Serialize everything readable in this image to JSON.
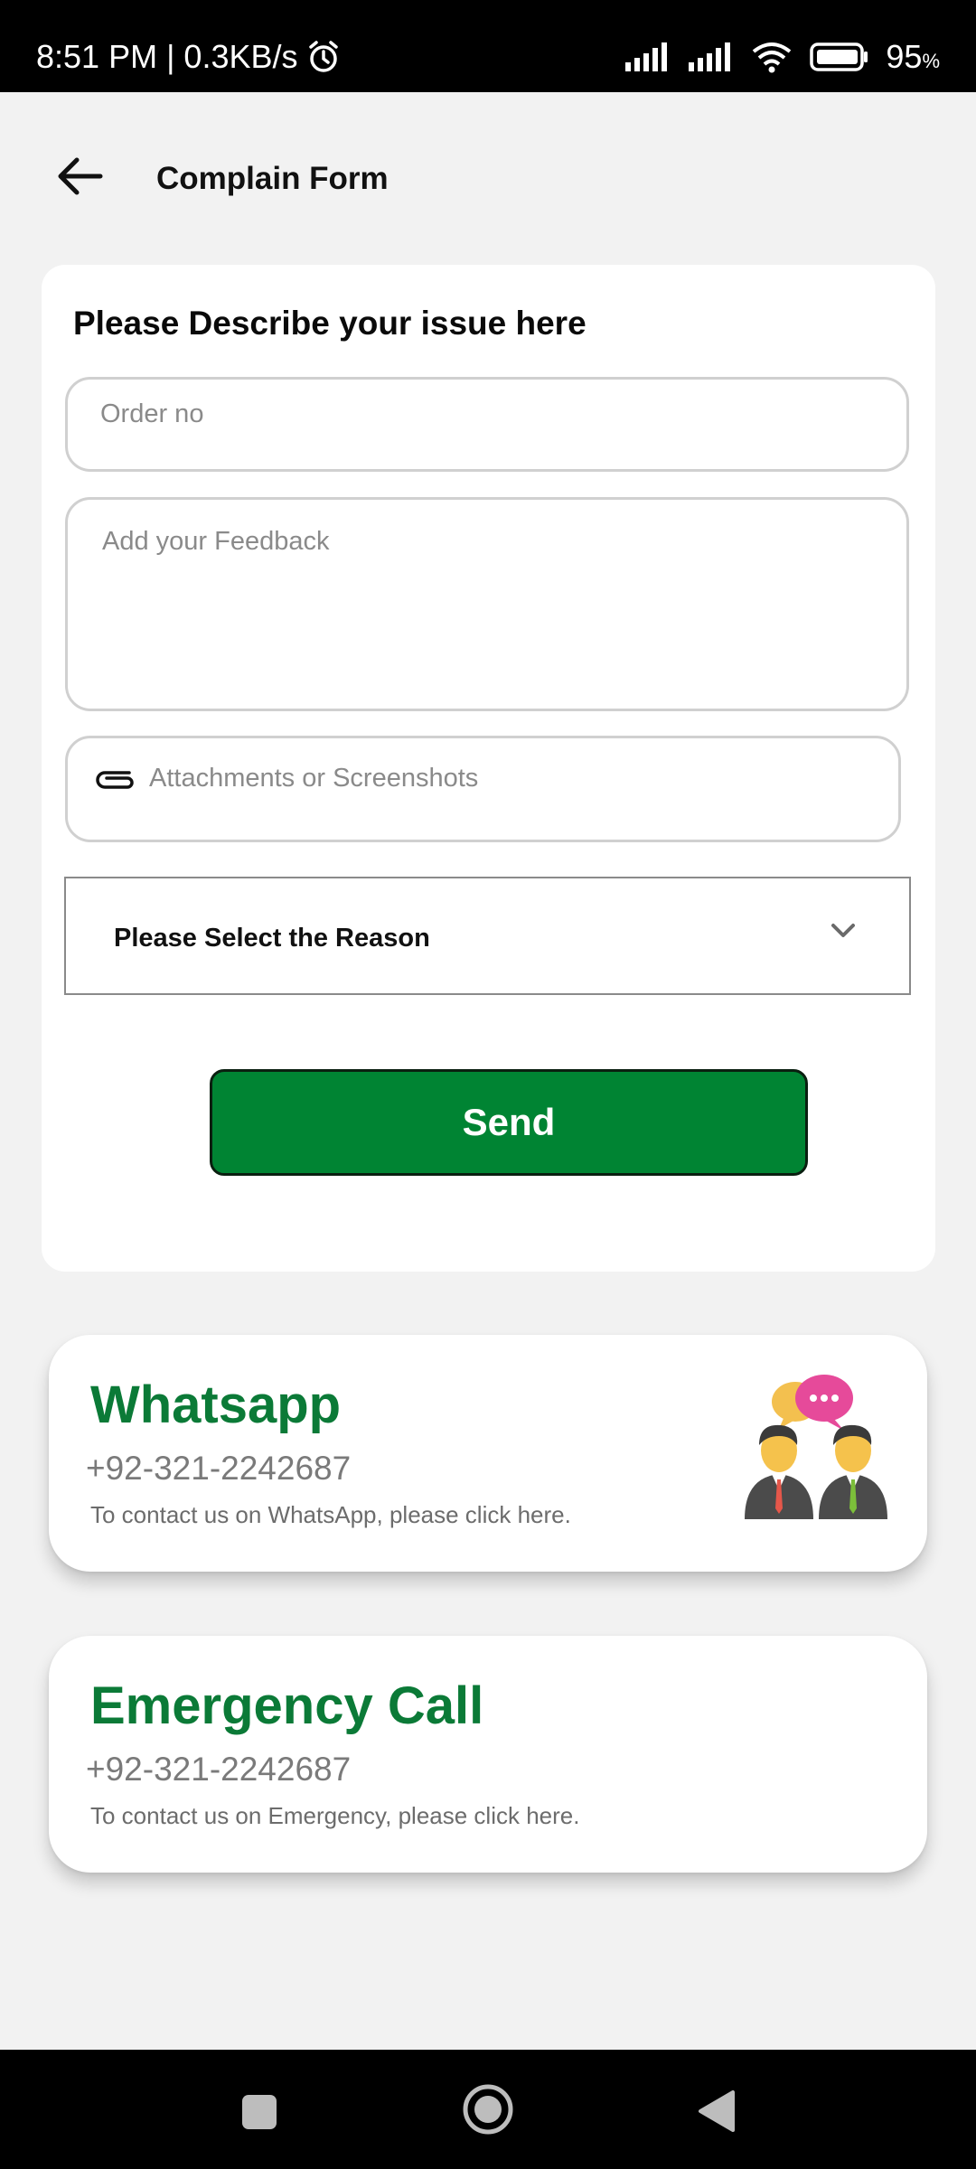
{
  "status_bar": {
    "time_speed": "8:51 PM | 0.3KB/s",
    "battery": "95",
    "battery_unit": "%"
  },
  "header": {
    "title": "Complain Form"
  },
  "form": {
    "heading": "Please Describe your issue here",
    "order_placeholder": "Order no",
    "feedback_placeholder": "Add your Feedback",
    "attachment_placeholder": "Attachments or Screenshots",
    "reason_select": "Please Select the Reason",
    "send_label": "Send"
  },
  "whatsapp": {
    "title": "Whatsapp",
    "phone": "+92-321-2242687",
    "description": "To contact us on WhatsApp, please click here."
  },
  "emergency": {
    "title": "Emergency Call",
    "phone": "+92-321-2242687",
    "description": "To contact us on Emergency, please click here."
  },
  "colors": {
    "accent_green": "#008433",
    "title_green": "#0b7a37",
    "background": "#f2f2f2"
  },
  "icons": [
    "back-arrow-icon",
    "alarm-icon",
    "signal-icon",
    "wifi-icon",
    "battery-icon",
    "paperclip-icon",
    "chevron-down-icon",
    "support-people-icon",
    "recents-icon",
    "home-icon",
    "back-icon"
  ]
}
